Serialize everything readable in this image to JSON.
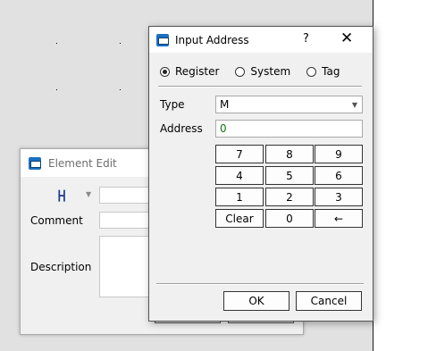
{
  "element_edit": {
    "title": "Element Edit",
    "contact_symbol": "┣┫",
    "comment_label": "Comment",
    "description_label": "Description"
  },
  "input_address": {
    "title": "Input Address",
    "help_label": "?",
    "close_label": "✕",
    "radios": [
      {
        "label": "Register",
        "selected": true
      },
      {
        "label": "System",
        "selected": false
      },
      {
        "label": "Tag",
        "selected": false
      }
    ],
    "type_label": "Type",
    "type_value": "M",
    "address_label": "Address",
    "address_value": "0",
    "keys": [
      "7",
      "8",
      "9",
      "4",
      "5",
      "6",
      "1",
      "2",
      "3",
      "Clear",
      "0",
      "←"
    ],
    "ok_label": "OK",
    "cancel_label": "Cancel"
  }
}
